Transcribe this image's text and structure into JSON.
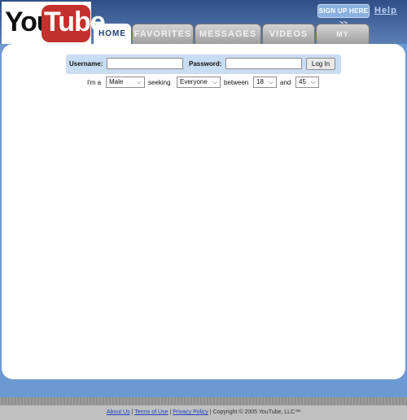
{
  "header": {
    "logo_you": "You",
    "logo_tube": "Tube",
    "signup_label": "SIGN UP HERE >>",
    "help_label": "Help"
  },
  "tabs": [
    {
      "label": "HOME",
      "active": true
    },
    {
      "label": "FAVORITES",
      "active": false
    },
    {
      "label": "MESSAGES",
      "active": false
    },
    {
      "label": "VIDEOS",
      "active": false
    },
    {
      "label": "MY PROFILE",
      "active": false
    }
  ],
  "login": {
    "username_label": "Username:",
    "username_value": "",
    "password_label": "Password:",
    "password_value": "",
    "button_label": "Log In"
  },
  "search": {
    "im_a_label": "I'm a",
    "gender_value": "Male",
    "seeking_label": "seeking",
    "seeking_value": "Everyone",
    "between_label": "between",
    "age_min_value": "18",
    "and_label": "and",
    "age_max_value": "45"
  },
  "footer": {
    "about": "About Us",
    "sep1": " | ",
    "terms": "Terms of Use",
    "sep2": " | ",
    "privacy": "Privacy Policy",
    "copyright": " | Copyright © 2005 YouTube, LLC™"
  },
  "colors": {
    "header_blue": "#304f86",
    "frame_blue": "#6d99d2",
    "logo_red": "#c4302b",
    "link_blue": "#1a3fc0"
  }
}
